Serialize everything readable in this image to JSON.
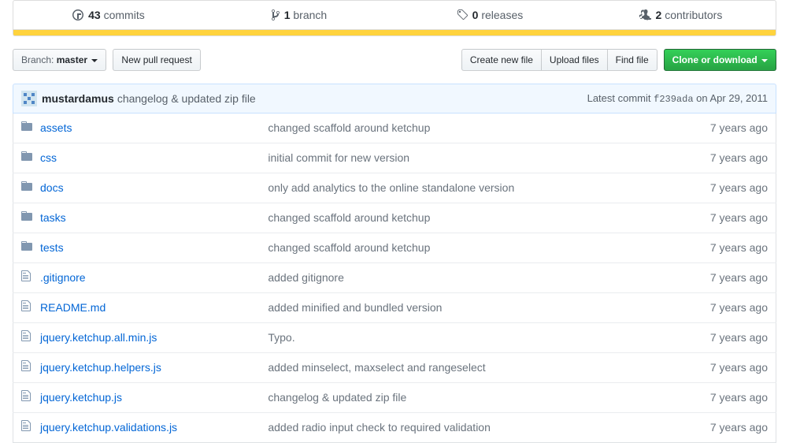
{
  "stats": {
    "commits_count": "43",
    "commits_label": "commits",
    "branches_count": "1",
    "branches_label": "branch",
    "releases_count": "0",
    "releases_label": "releases",
    "contributors_count": "2",
    "contributors_label": "contributors"
  },
  "toolbar": {
    "branch_prefix": "Branch: ",
    "branch_name": "master",
    "new_pr": "New pull request",
    "create_file": "Create new file",
    "upload_files": "Upload files",
    "find_file": "Find file",
    "clone": "Clone or download"
  },
  "commit": {
    "author": "mustardamus",
    "message": "changelog & updated zip file",
    "latest_label": "Latest commit ",
    "sha": "f239ada",
    "date": " on Apr 29, 2011"
  },
  "files": [
    {
      "type": "folder",
      "name": "assets",
      "msg": "changed scaffold around ketchup",
      "age": "7 years ago"
    },
    {
      "type": "folder",
      "name": "css",
      "msg": "initial commit for new version",
      "age": "7 years ago"
    },
    {
      "type": "folder",
      "name": "docs",
      "msg": "only add analytics to the online standalone version",
      "age": "7 years ago"
    },
    {
      "type": "folder",
      "name": "tasks",
      "msg": "changed scaffold around ketchup",
      "age": "7 years ago"
    },
    {
      "type": "folder",
      "name": "tests",
      "msg": "changed scaffold around ketchup",
      "age": "7 years ago"
    },
    {
      "type": "file",
      "name": ".gitignore",
      "msg": "added gitignore",
      "age": "7 years ago"
    },
    {
      "type": "file",
      "name": "README.md",
      "msg": "added minified and bundled version",
      "age": "7 years ago"
    },
    {
      "type": "file",
      "name": "jquery.ketchup.all.min.js",
      "msg": "Typo.",
      "age": "7 years ago"
    },
    {
      "type": "file",
      "name": "jquery.ketchup.helpers.js",
      "msg": "added minselect, maxselect and rangeselect",
      "age": "7 years ago"
    },
    {
      "type": "file",
      "name": "jquery.ketchup.js",
      "msg": "changelog & updated zip file",
      "age": "7 years ago"
    },
    {
      "type": "file",
      "name": "jquery.ketchup.validations.js",
      "msg": "added radio input check to required validation",
      "age": "7 years ago"
    }
  ]
}
